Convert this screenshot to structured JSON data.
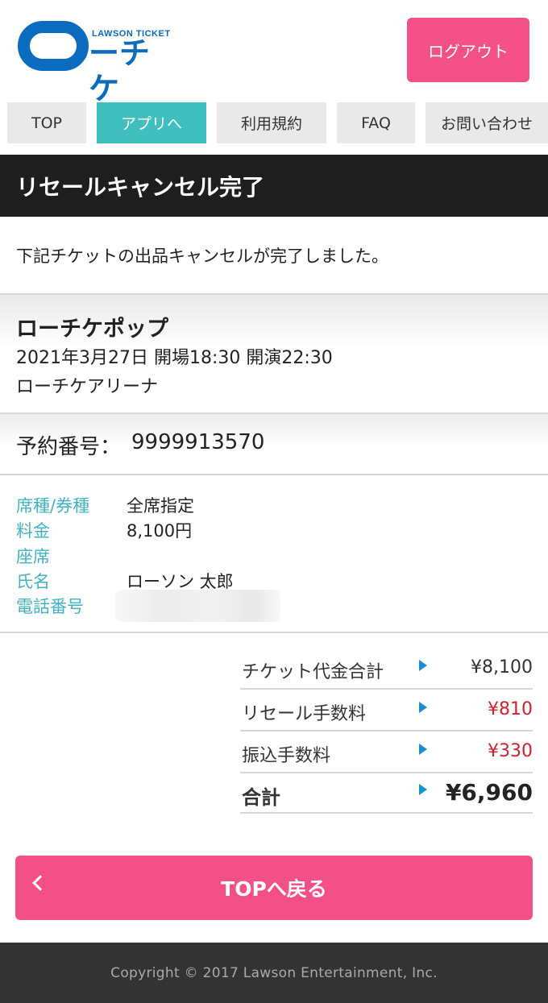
{
  "header": {
    "logo_small": "LAWSON TICKET",
    "logo_main": "ーチケ",
    "logout_label": "ログアウト"
  },
  "nav": {
    "tabs": [
      {
        "label": "TOP",
        "active": false
      },
      {
        "label": "アプリへ",
        "active": true
      },
      {
        "label": "利用規約",
        "active": false
      },
      {
        "label": "FAQ",
        "active": false
      },
      {
        "label": "お問い合わせ",
        "active": false
      }
    ]
  },
  "page": {
    "title": "リセールキャンセル完了",
    "message": "下記チケットの出品キャンセルが完了しました。"
  },
  "event": {
    "name": "ローチケポップ",
    "datetime": "2021年3月27日 開場18:30 開演22:30",
    "venue": "ローチケアリーナ"
  },
  "reservation": {
    "label": "予約番号：",
    "number": "9999913570"
  },
  "details": [
    {
      "label": "席種/券種",
      "value": "全席指定"
    },
    {
      "label": "料金",
      "value": "8,100円"
    },
    {
      "label": "座席",
      "value": ""
    },
    {
      "label": "氏名",
      "value": "ローソン 太郎"
    },
    {
      "label": "電話番号",
      "value": ""
    }
  ],
  "fees": [
    {
      "label": "チケット代金合計",
      "value": "¥8,100",
      "highlight": false
    },
    {
      "label": "リセール手数料",
      "value": "¥810",
      "highlight": true
    },
    {
      "label": "振込手数料",
      "value": "¥330",
      "highlight": true
    },
    {
      "label": "合計",
      "value": "¥6,960",
      "highlight": false
    }
  ],
  "back_button": {
    "label": "TOPへ戻る"
  },
  "footer": {
    "copyright": "Copyright © 2017 Lawson Entertainment, Inc."
  },
  "colors": {
    "brand_blue": "#0a6cbf",
    "accent_pink": "#f25086",
    "tab_teal": "#3fbfbd",
    "label_teal": "#3fb3c4",
    "fee_red": "#d12030"
  }
}
